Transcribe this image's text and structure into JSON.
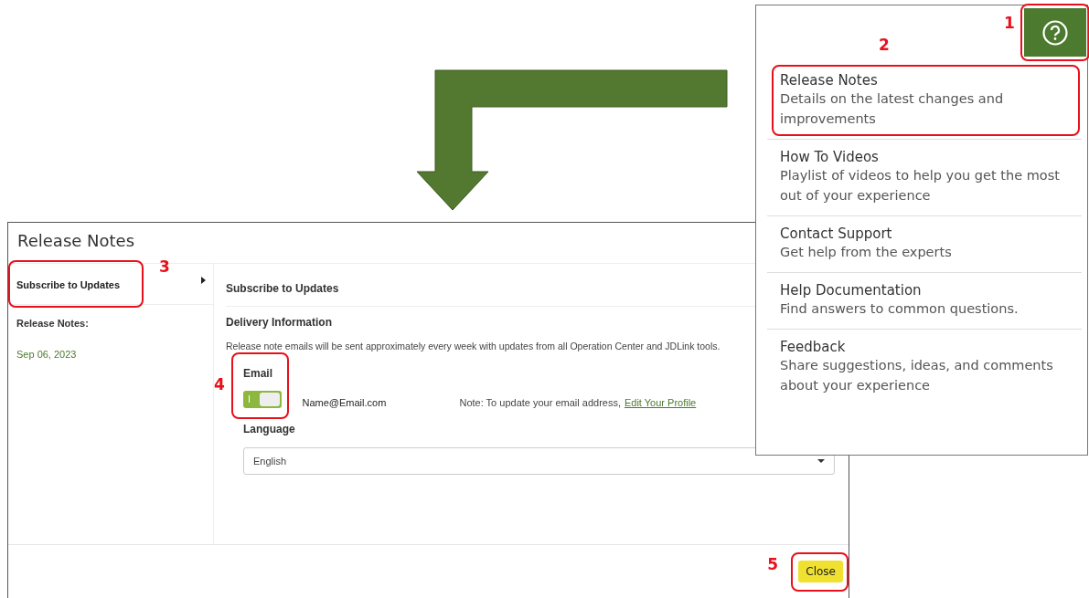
{
  "help_button": {
    "callout": "1"
  },
  "help_menu": {
    "items": [
      {
        "title": "Release Notes",
        "description": "Details on the latest changes and improvements",
        "callout": "2"
      },
      {
        "title": "How To Videos",
        "description": "Playlist of videos to help you get the most out of your experience"
      },
      {
        "title": "Contact Support",
        "description": "Get help from the experts"
      },
      {
        "title": "Help Documentation",
        "description": "Find answers to common questions."
      },
      {
        "title": "Feedback",
        "description": "Share suggestions, ideas, and comments about your experience"
      }
    ]
  },
  "dialog": {
    "title": "Release Notes",
    "sidebar": {
      "items": [
        {
          "label": "Subscribe to Updates",
          "selected": true,
          "callout": "3"
        }
      ],
      "section_label": "Release Notes:",
      "dates": [
        "Sep 06, 2023"
      ]
    },
    "content": {
      "heading": "Subscribe to Updates",
      "subheading": "Delivery Information",
      "description": "Release note emails will be sent approximately every week with updates from all Operation Center and JDLink tools.",
      "email": {
        "label": "Email",
        "enabled": true,
        "callout": "4",
        "address": "Name@Email.com",
        "note": "Note: To update your email address,",
        "link": "Edit Your Profile"
      },
      "language": {
        "label": "Language",
        "value": "English"
      }
    },
    "close_button": {
      "label": "Close",
      "callout": "5"
    }
  }
}
